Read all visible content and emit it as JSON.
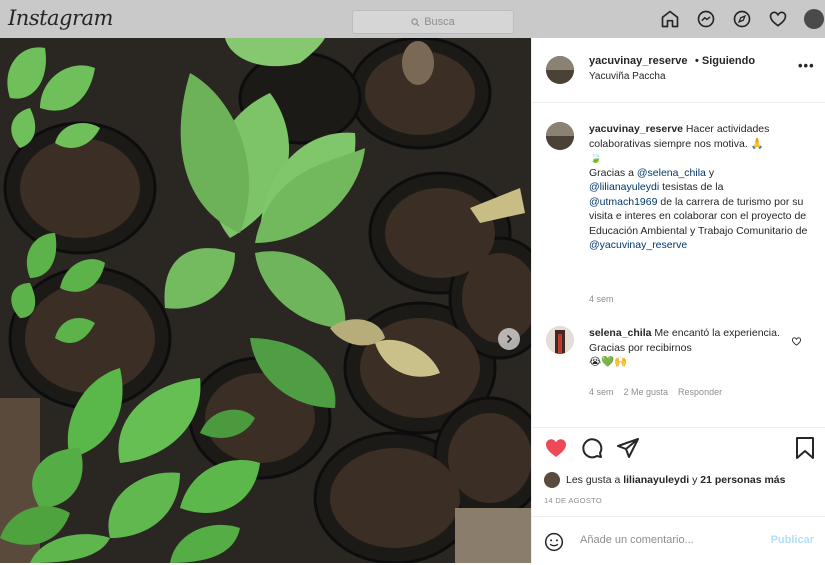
{
  "nav": {
    "logo": "Instagram",
    "search_placeholder": "Busca",
    "icons": [
      "home-icon",
      "messenger-icon",
      "explore-icon",
      "heart-icon",
      "avatar"
    ]
  },
  "post": {
    "username": "yacuvinay_reserve",
    "follow_state": "• Siguiendo",
    "location": "Yacuviña Paccha",
    "more": "•••",
    "caption": {
      "username": "yacuvinay_reserve",
      "text1": "Hacer actividades colaborativas siempre nos motiva. 🙏",
      "emoji_line": "🍃",
      "thanks_pre": "Gracias a",
      "mention1": "@selena_chila",
      "and": "y",
      "mention2": "@lilianayuleydi",
      "mid1": "tesistas de la",
      "mention3": "@utmach1969",
      "mid2": "de la carrera de turismo por su visita e interes en colaborar con el proyecto de Educación Ambiental y Trabajo Comunitario de",
      "mention4": "@yacuvinay_reserve",
      "time": "4 sem"
    },
    "comment": {
      "username": "selena_chila",
      "text": "Me encantó la experiencia. Gracias por recibirnos",
      "emojis": "😭💚🙌",
      "time": "4 sem",
      "likes": "2 Me gusta",
      "reply": "Responder"
    },
    "likes": {
      "pre": "Les gusta a",
      "user": "lilianayuleydi",
      "mid": "y",
      "others": "21 personas más"
    },
    "date": "14 DE AGOSTO",
    "add_comment_placeholder": "Añade un comentario...",
    "publish_label": "Publicar"
  },
  "carousel": {
    "total": 7,
    "active_index": 0
  },
  "colors": {
    "like_red": "#ed4956",
    "link_blue": "#00376b",
    "publish_blue": "#b2dffc",
    "dot_active": "#4fa3f7"
  }
}
